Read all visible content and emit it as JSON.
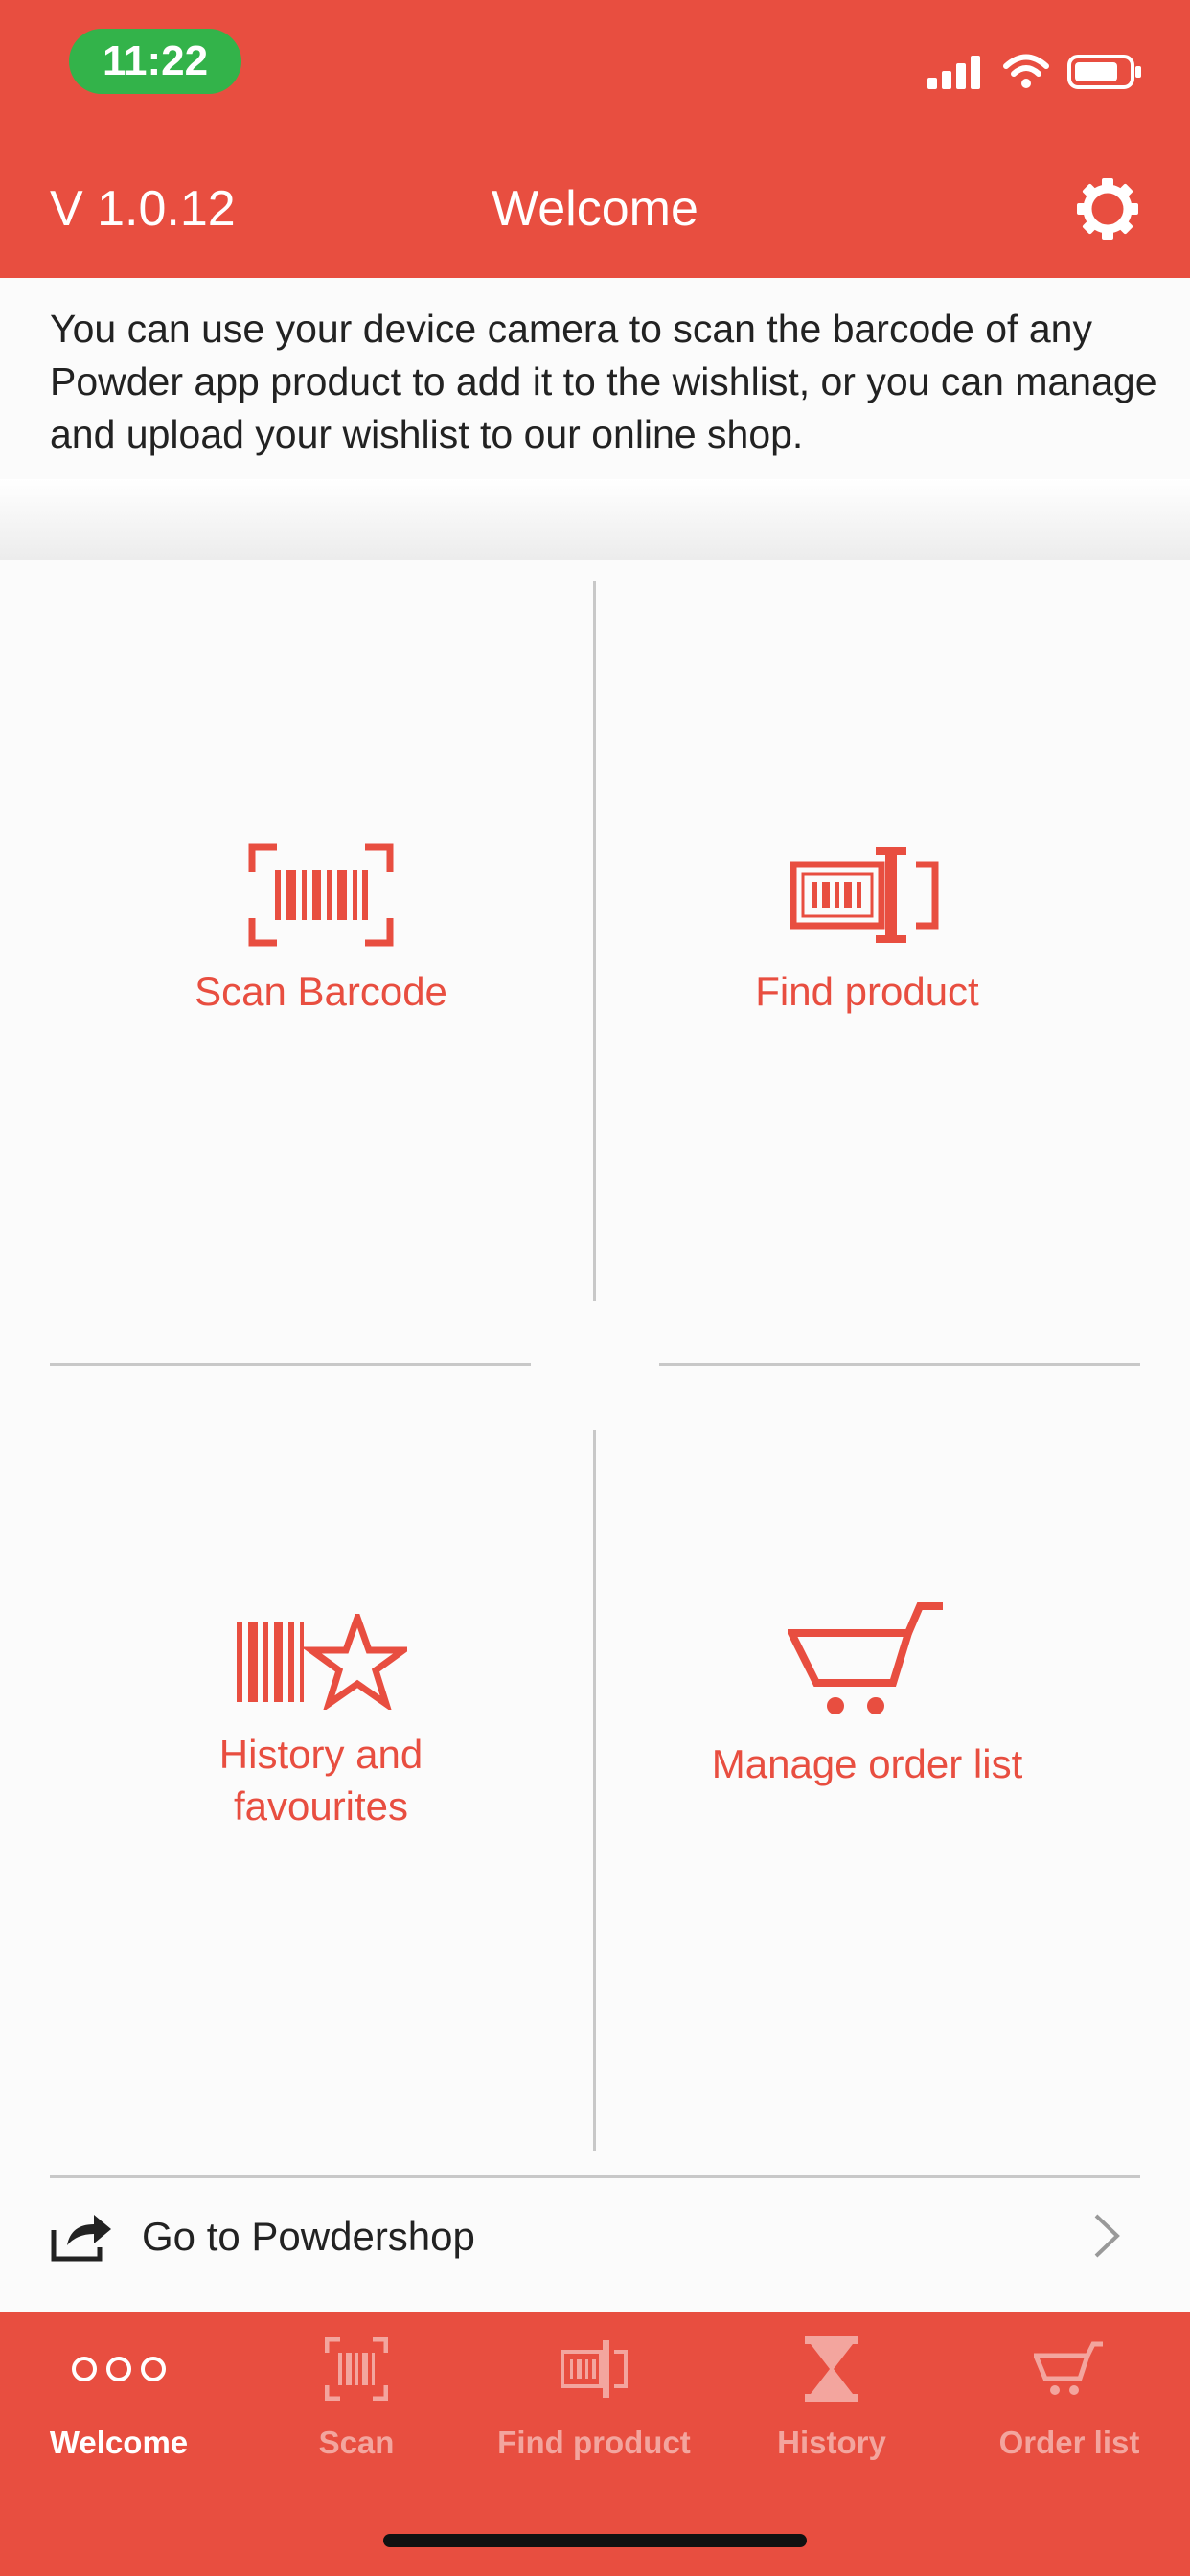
{
  "status_bar": {
    "time": "11:22"
  },
  "header": {
    "version": "V 1.0.12",
    "title": "Welcome"
  },
  "intro": {
    "text": "You can use your device camera to scan the barcode of any Powder app product to add it to the wishlist, or you can manage and upload your wishlist to our online shop."
  },
  "tiles": [
    {
      "label": "Scan Barcode",
      "icon": "scan-barcode-icon"
    },
    {
      "label": "Find product",
      "icon": "find-product-icon"
    },
    {
      "label": "History and favourites",
      "icon": "history-favourites-icon"
    },
    {
      "label": "Manage order list",
      "icon": "cart-icon"
    }
  ],
  "shop_link": {
    "label": "Go to Powdershop",
    "icon": "share-icon"
  },
  "tabbar": {
    "items": [
      {
        "label": "Welcome",
        "icon": "dots-icon",
        "active": true
      },
      {
        "label": "Scan",
        "icon": "scan-icon",
        "active": false
      },
      {
        "label": "Find product",
        "icon": "find-icon",
        "active": false
      },
      {
        "label": "History",
        "icon": "hourglass-icon",
        "active": false
      },
      {
        "label": "Order list",
        "icon": "cart-icon",
        "active": false
      }
    ]
  },
  "colors": {
    "accent": "#e84e40",
    "status_pill": "#33b34a",
    "divider": "#c8c8c8"
  }
}
